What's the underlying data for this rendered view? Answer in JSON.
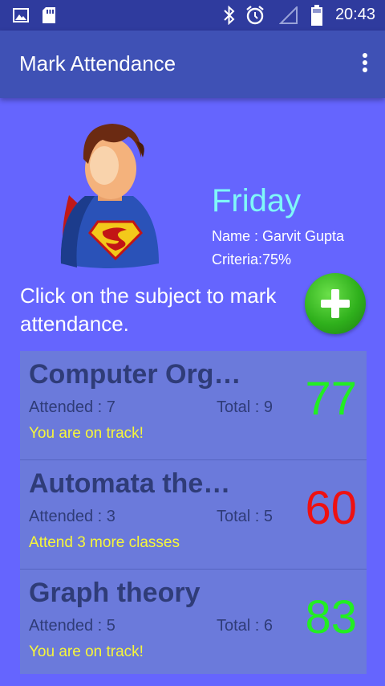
{
  "status_bar": {
    "time": "20:43"
  },
  "app_bar": {
    "title": "Mark Attendance",
    "menu_icon": "overflow-menu-icon"
  },
  "profile": {
    "day": "Friday",
    "name": "Name : Garvit Gupta",
    "criteria": "Criteria:75%",
    "avatar_icon": "superman-avatar-icon"
  },
  "instruction": "Click on the subject to mark attendance.",
  "add_button": {
    "icon": "plus-icon",
    "color": "#2fb01c"
  },
  "subjects": [
    {
      "name": "Computer Org…",
      "attended": "Attended : 7",
      "total": "Total : 9",
      "status": "You are on track!",
      "percent": "77",
      "percent_color": "#22ee22"
    },
    {
      "name": "Automata the…",
      "attended": "Attended : 3",
      "total": "Total : 5",
      "status": "Attend 3 more classes",
      "percent": "60",
      "percent_color": "#ee1111"
    },
    {
      "name": "Graph theory",
      "attended": "Attended : 5",
      "total": "Total : 6",
      "status": "You are on track!",
      "percent": "83",
      "percent_color": "#22ee22"
    }
  ]
}
